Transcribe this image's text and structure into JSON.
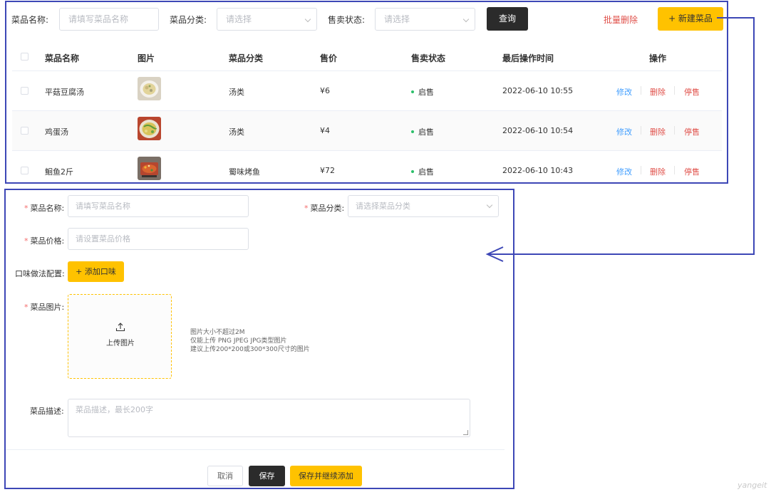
{
  "filters": {
    "name_label": "菜品名称:",
    "name_placeholder": "请填写菜品名称",
    "category_label": "菜品分类:",
    "category_placeholder": "请选择",
    "status_label": "售卖状态:",
    "status_placeholder": "请选择",
    "query_label": "查询",
    "batch_delete_label": "批量删除",
    "new_dish_label": "+ 新建菜品"
  },
  "table": {
    "headers": {
      "name": "菜品名称",
      "image": "图片",
      "category": "菜品分类",
      "price": "售价",
      "status": "售卖状态",
      "updated": "最后操作时间",
      "actions": "操作"
    },
    "rows": [
      {
        "name": "平菇豆腐汤",
        "image_icon": "dish-thumbnail-soup-icon",
        "category": "汤类",
        "price": "¥6",
        "status": "启售",
        "updated": "2022-06-10 10:55",
        "edit": "修改",
        "delete": "删除",
        "stop": "停售"
      },
      {
        "name": "鸡蛋汤",
        "image_icon": "dish-thumbnail-egg-soup-icon",
        "category": "汤类",
        "price": "¥4",
        "status": "启售",
        "updated": "2022-06-10 10:54",
        "edit": "修改",
        "delete": "删除",
        "stop": "停售"
      },
      {
        "name": "鮰鱼2斤",
        "image_icon": "dish-thumbnail-grilled-fish-icon",
        "category": "蜀味烤鱼",
        "price": "¥72",
        "status": "启售",
        "updated": "2022-06-10 10:43",
        "edit": "修改",
        "delete": "删除",
        "stop": "停售"
      }
    ]
  },
  "form": {
    "name_label": "菜品名称:",
    "name_placeholder": "请填写菜品名称",
    "category_label": "菜品分类:",
    "category_placeholder": "请选择菜品分类",
    "price_label": "菜品价格:",
    "price_placeholder": "请设置菜品价格",
    "flavor_label": "口味做法配置:",
    "add_flavor_label": "+ 添加口味",
    "image_label": "菜品图片:",
    "upload_label": "上传图片",
    "upload_tips": [
      "图片大小不超过2M",
      "仅能上传 PNG JPEG JPG类型图片",
      "建议上传200*200或300*300尺寸的图片"
    ],
    "desc_label": "菜品描述:",
    "desc_placeholder": "菜品描述，最长200字",
    "cancel_label": "取消",
    "save_label": "保存",
    "save_continue_label": "保存并继续添加"
  },
  "watermark": "yangeit",
  "colors": {
    "accent": "#ffc200",
    "dark_button": "#2b2b2b",
    "danger": "#e0504a",
    "link": "#419eff",
    "status_on": "#2bbf6a",
    "annotation_border": "#3d47b6"
  }
}
